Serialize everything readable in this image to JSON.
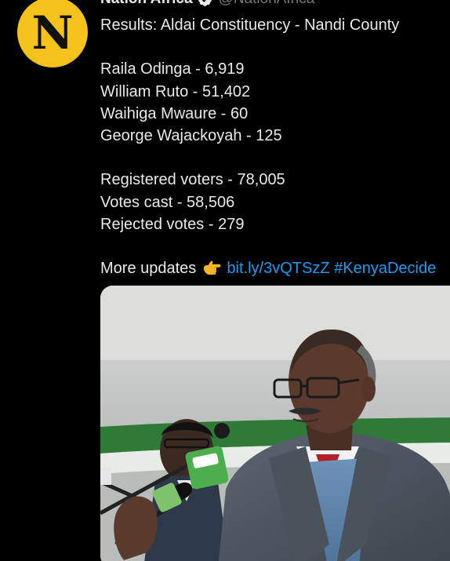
{
  "author": {
    "display_name": "Nation Africa",
    "handle": "@NationAfrica",
    "separator": "·",
    "avatar_letter": "N",
    "avatar_color": "#f4c21b",
    "verified_icon": "verified-badge-icon"
  },
  "tweet": {
    "heading": "Results: Aldai Constituency - Nandi County",
    "candidates": [
      "Raila Odinga -  6,919",
      "William Ruto - 51,402",
      "Waihiga Mwaure - 60",
      "George Wajackoyah  - 125"
    ],
    "stats": [
      "Registered voters - 78,005",
      "Votes cast - 58,506",
      "Rejected votes - 279"
    ],
    "updates_label": "More updates",
    "updates_icon": "pointing-hand-icon",
    "link_text": "bit.ly/3vQTSzZ",
    "hashtag": "#KenyaDecide"
  },
  "colors": {
    "background": "#000000",
    "text": "#e7e9ea",
    "muted": "#71767b",
    "link": "#1d9bf0"
  },
  "media": {
    "type": "photo",
    "subject": "photo-of-speaker-at-microphones"
  }
}
